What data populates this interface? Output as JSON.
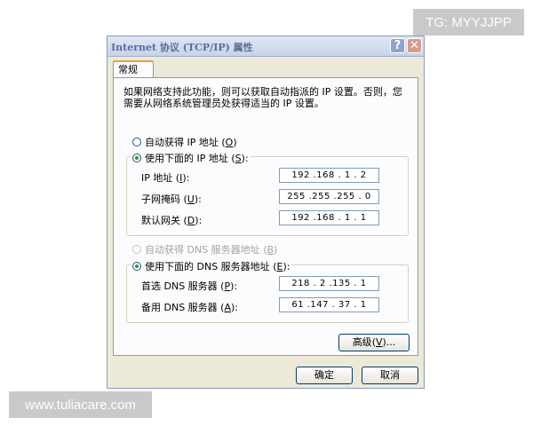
{
  "watermarks": {
    "top_right": "TG: MYYJJPP",
    "bottom_left": "www.tuliacare.com"
  },
  "window": {
    "title": "Internet 协议 (TCP/IP) 属性",
    "help_glyph": "?",
    "close_glyph": "✕"
  },
  "tabs": [
    {
      "label": "常规",
      "selected": true
    }
  ],
  "description": "如果网络支持此功能，则可以获取自动指派的 IP 设置。否则，您需要从网络系统管理员处获得适当的 IP 设置。",
  "ip_mode": {
    "auto": {
      "label": "自动获得 IP 地址",
      "key": "O",
      "paren_open": "(",
      "paren_close": ")",
      "selected": false
    },
    "manual": {
      "label": "使用下面的 IP 地址",
      "key": "S",
      "paren_open": "(",
      "paren_close": "):",
      "selected": true
    }
  },
  "ip_fields": [
    {
      "label": "IP 地址",
      "key": "I",
      "value": "192 .168 . 1 . 2"
    },
    {
      "label": "子网掩码",
      "key": "U",
      "value": "255 .255 .255 . 0"
    },
    {
      "label": "默认网关",
      "key": "D",
      "value": "192 .168 . 1 . 1"
    }
  ],
  "dns_mode": {
    "auto": {
      "label": "自动获得 DNS 服务器地址",
      "key": "B",
      "paren_open": "(",
      "paren_close": ")",
      "selected": false,
      "disabled": true
    },
    "manual": {
      "label": "使用下面的 DNS 服务器地址",
      "key": "E",
      "paren_open": "(",
      "paren_close": "):",
      "selected": true
    }
  },
  "dns_fields": [
    {
      "label": "首选 DNS 服务器",
      "key": "P",
      "value": "218 . 2 .135 . 1"
    },
    {
      "label": "备用 DNS 服务器",
      "key": "A",
      "value": "61 .147 . 37 . 1"
    }
  ],
  "buttons": {
    "advanced": {
      "label": "高级",
      "key": "V",
      "suffix": ")..."
    },
    "ok": "确定",
    "cancel": "取消"
  },
  "colors": {
    "dialog_bg": "#ece9d8",
    "title_text": "#5a6e9c",
    "tab_accent": "#e6a040",
    "radio_dot": "#21a121"
  }
}
